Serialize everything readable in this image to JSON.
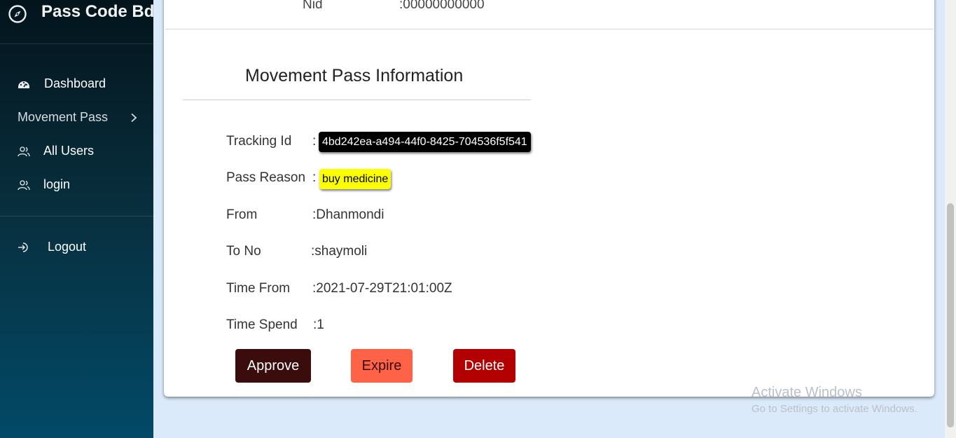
{
  "brand": {
    "title": "Pass Code Bd",
    "icon": "compass-icon"
  },
  "sidebar": {
    "items": [
      {
        "label": "Dashboard",
        "icon": "dashboard-icon"
      },
      {
        "label": "Movement Pass",
        "icon": "chevron-right-icon"
      },
      {
        "label": "All Users",
        "icon": "users-icon"
      },
      {
        "label": "login",
        "icon": "users-icon"
      },
      {
        "label": "Logout",
        "icon": "logout-icon"
      }
    ]
  },
  "profile": {
    "nid_label": "Nid",
    "nid_value": ":00000000000"
  },
  "section": {
    "title": "Movement Pass Information"
  },
  "info": {
    "tracking_label": "Tracking Id",
    "tracking_value": "4bd242ea-a494-44f0-8425-704536f5f541",
    "reason_label": "Pass Reason",
    "reason_value": "buy medicine",
    "from_label": "From",
    "from_value": ":Dhanmondi",
    "to_label": "To No",
    "to_value": ":shaymoli",
    "time_from_label": "Time From",
    "time_from_value": ":2021-07-29T21:01:00Z",
    "time_spend_label": "Time Spend",
    "time_spend_value": ":1",
    "colon": ":"
  },
  "actions": {
    "approve": "Approve",
    "expire": "Expire",
    "delete": "Delete"
  },
  "watermark": {
    "title": "Activate Windows",
    "subtitle": "Go to Settings to activate Windows."
  },
  "colors": {
    "approve": "#3a0c0c",
    "expire": "#ff6347",
    "delete": "#b30000",
    "highlight_yellow": "#fbff00",
    "badge_dark": "#000000",
    "page_bg": "#dbeafb"
  }
}
